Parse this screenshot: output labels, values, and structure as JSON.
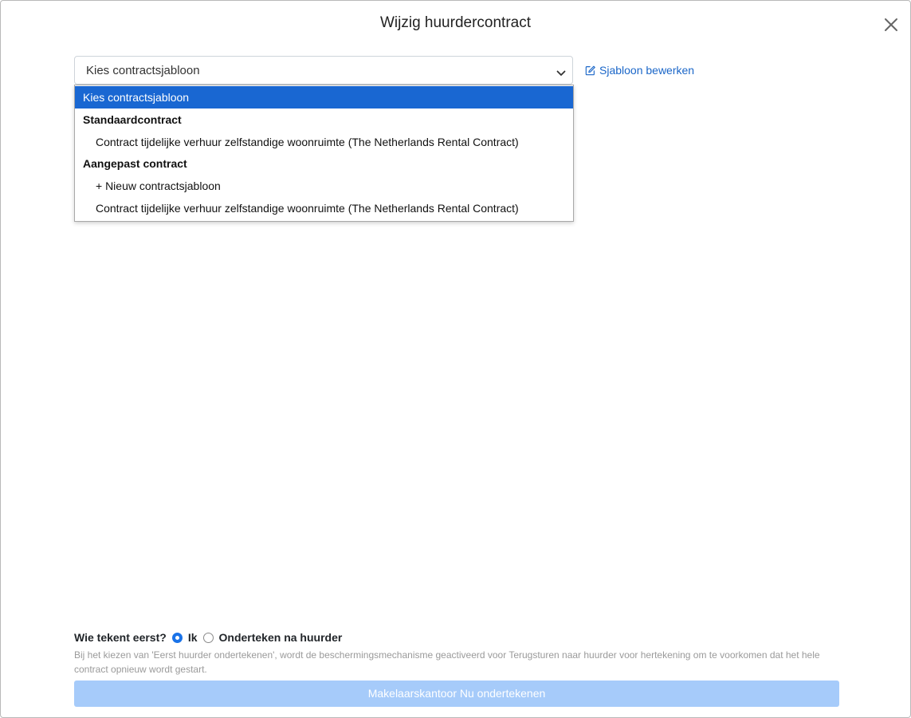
{
  "modal": {
    "title": "Wijzig huurdercontract",
    "close_icon": "close-icon"
  },
  "template_select": {
    "value": "Kies contractsjabloon",
    "arrow_icon": "chevron-down-icon"
  },
  "edit_template_link": {
    "label": "Sjabloon bewerken",
    "icon": "edit-icon",
    "color": "#1a66c8"
  },
  "dropdown": {
    "selected_color": "#1967d2",
    "placeholder": "Kies contractsjabloon",
    "group_standard": "Standaardcontract",
    "standard_option": "Contract tijdelijke verhuur zelfstandige woonruimte (The Netherlands Rental Contract)",
    "group_custom": "Aangepast contract",
    "new_template": "+ Nieuw contractsjabloon",
    "custom_option": "Contract tijdelijke verhuur zelfstandige woonruimte (The Netherlands Rental Contract)"
  },
  "signer": {
    "label": "Wie tekent eerst?",
    "option_me": "Ik",
    "option_after": "Onderteken na huurder",
    "selected": "Ik",
    "help_text": "Bij het kiezen van 'Eerst huurder ondertekenen', wordt de beschermingsmechanisme geactiveerd voor Terugsturen naar huurder voor hertekening om te voorkomen dat het hele contract opnieuw wordt gestart."
  },
  "sign_button": {
    "label": "Makelaarskantoor Nu ondertekenen",
    "color": "#a6cbfa"
  }
}
